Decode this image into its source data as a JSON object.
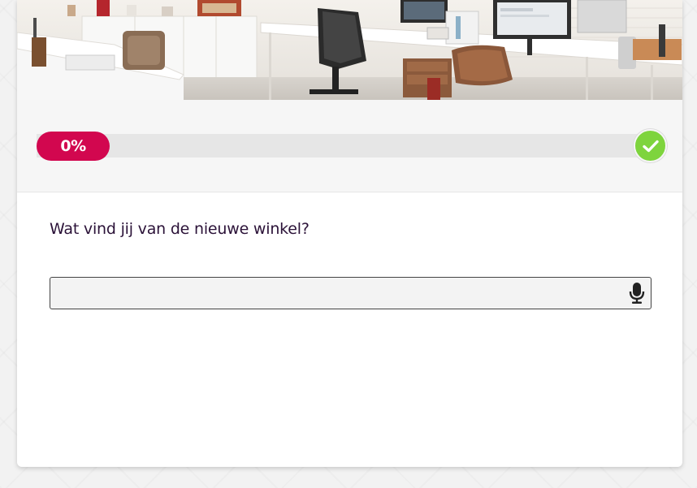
{
  "progress": {
    "label": "0%",
    "value": 0
  },
  "question": {
    "text": "Wat vind jij van de nieuwe winkel?"
  },
  "answer": {
    "value": "",
    "placeholder": ""
  },
  "icons": {
    "complete": "check-icon",
    "voice": "microphone-icon"
  },
  "colors": {
    "accent": "#d2074f",
    "success": "#7ed43d",
    "question_text": "#2b1238"
  }
}
